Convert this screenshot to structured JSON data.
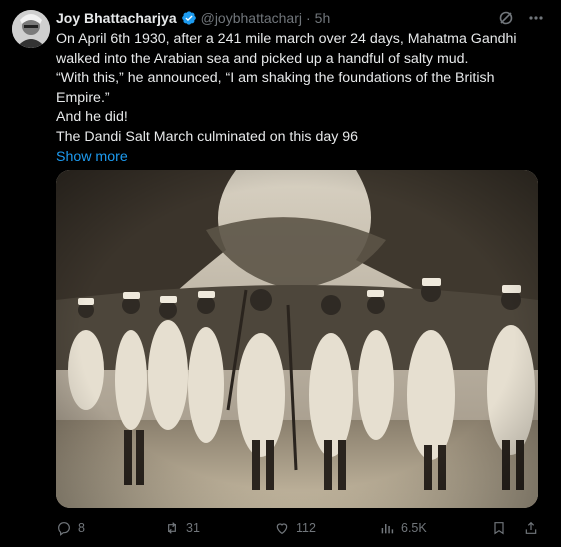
{
  "post": {
    "author_name": "Joy Bhattacharjya",
    "handle": "@joybhattacharj",
    "separator": "·",
    "time": "5h",
    "paragraphs": [
      "On April 6th 1930, after a 241 mile march over 24 days, Mahatma Gandhi walked into the Arabian sea and picked up a handful of salty mud.",
      "“With this,” he announced, “I am shaking the foundations of the British Empire.”",
      "And he did!",
      "The Dandi Salt March culminated on this day 96"
    ],
    "show_more": "Show more"
  },
  "icons": {
    "verified": "verified-badge-icon",
    "grok": "grok-icon",
    "more": "more-icon"
  },
  "actions": {
    "replies": "8",
    "reposts": "31",
    "likes": "112",
    "views": "6.5K"
  },
  "colors": {
    "background": "#000000",
    "text": "#e7e9ea",
    "secondary": "#71767b",
    "accent": "#1d9bf0"
  }
}
